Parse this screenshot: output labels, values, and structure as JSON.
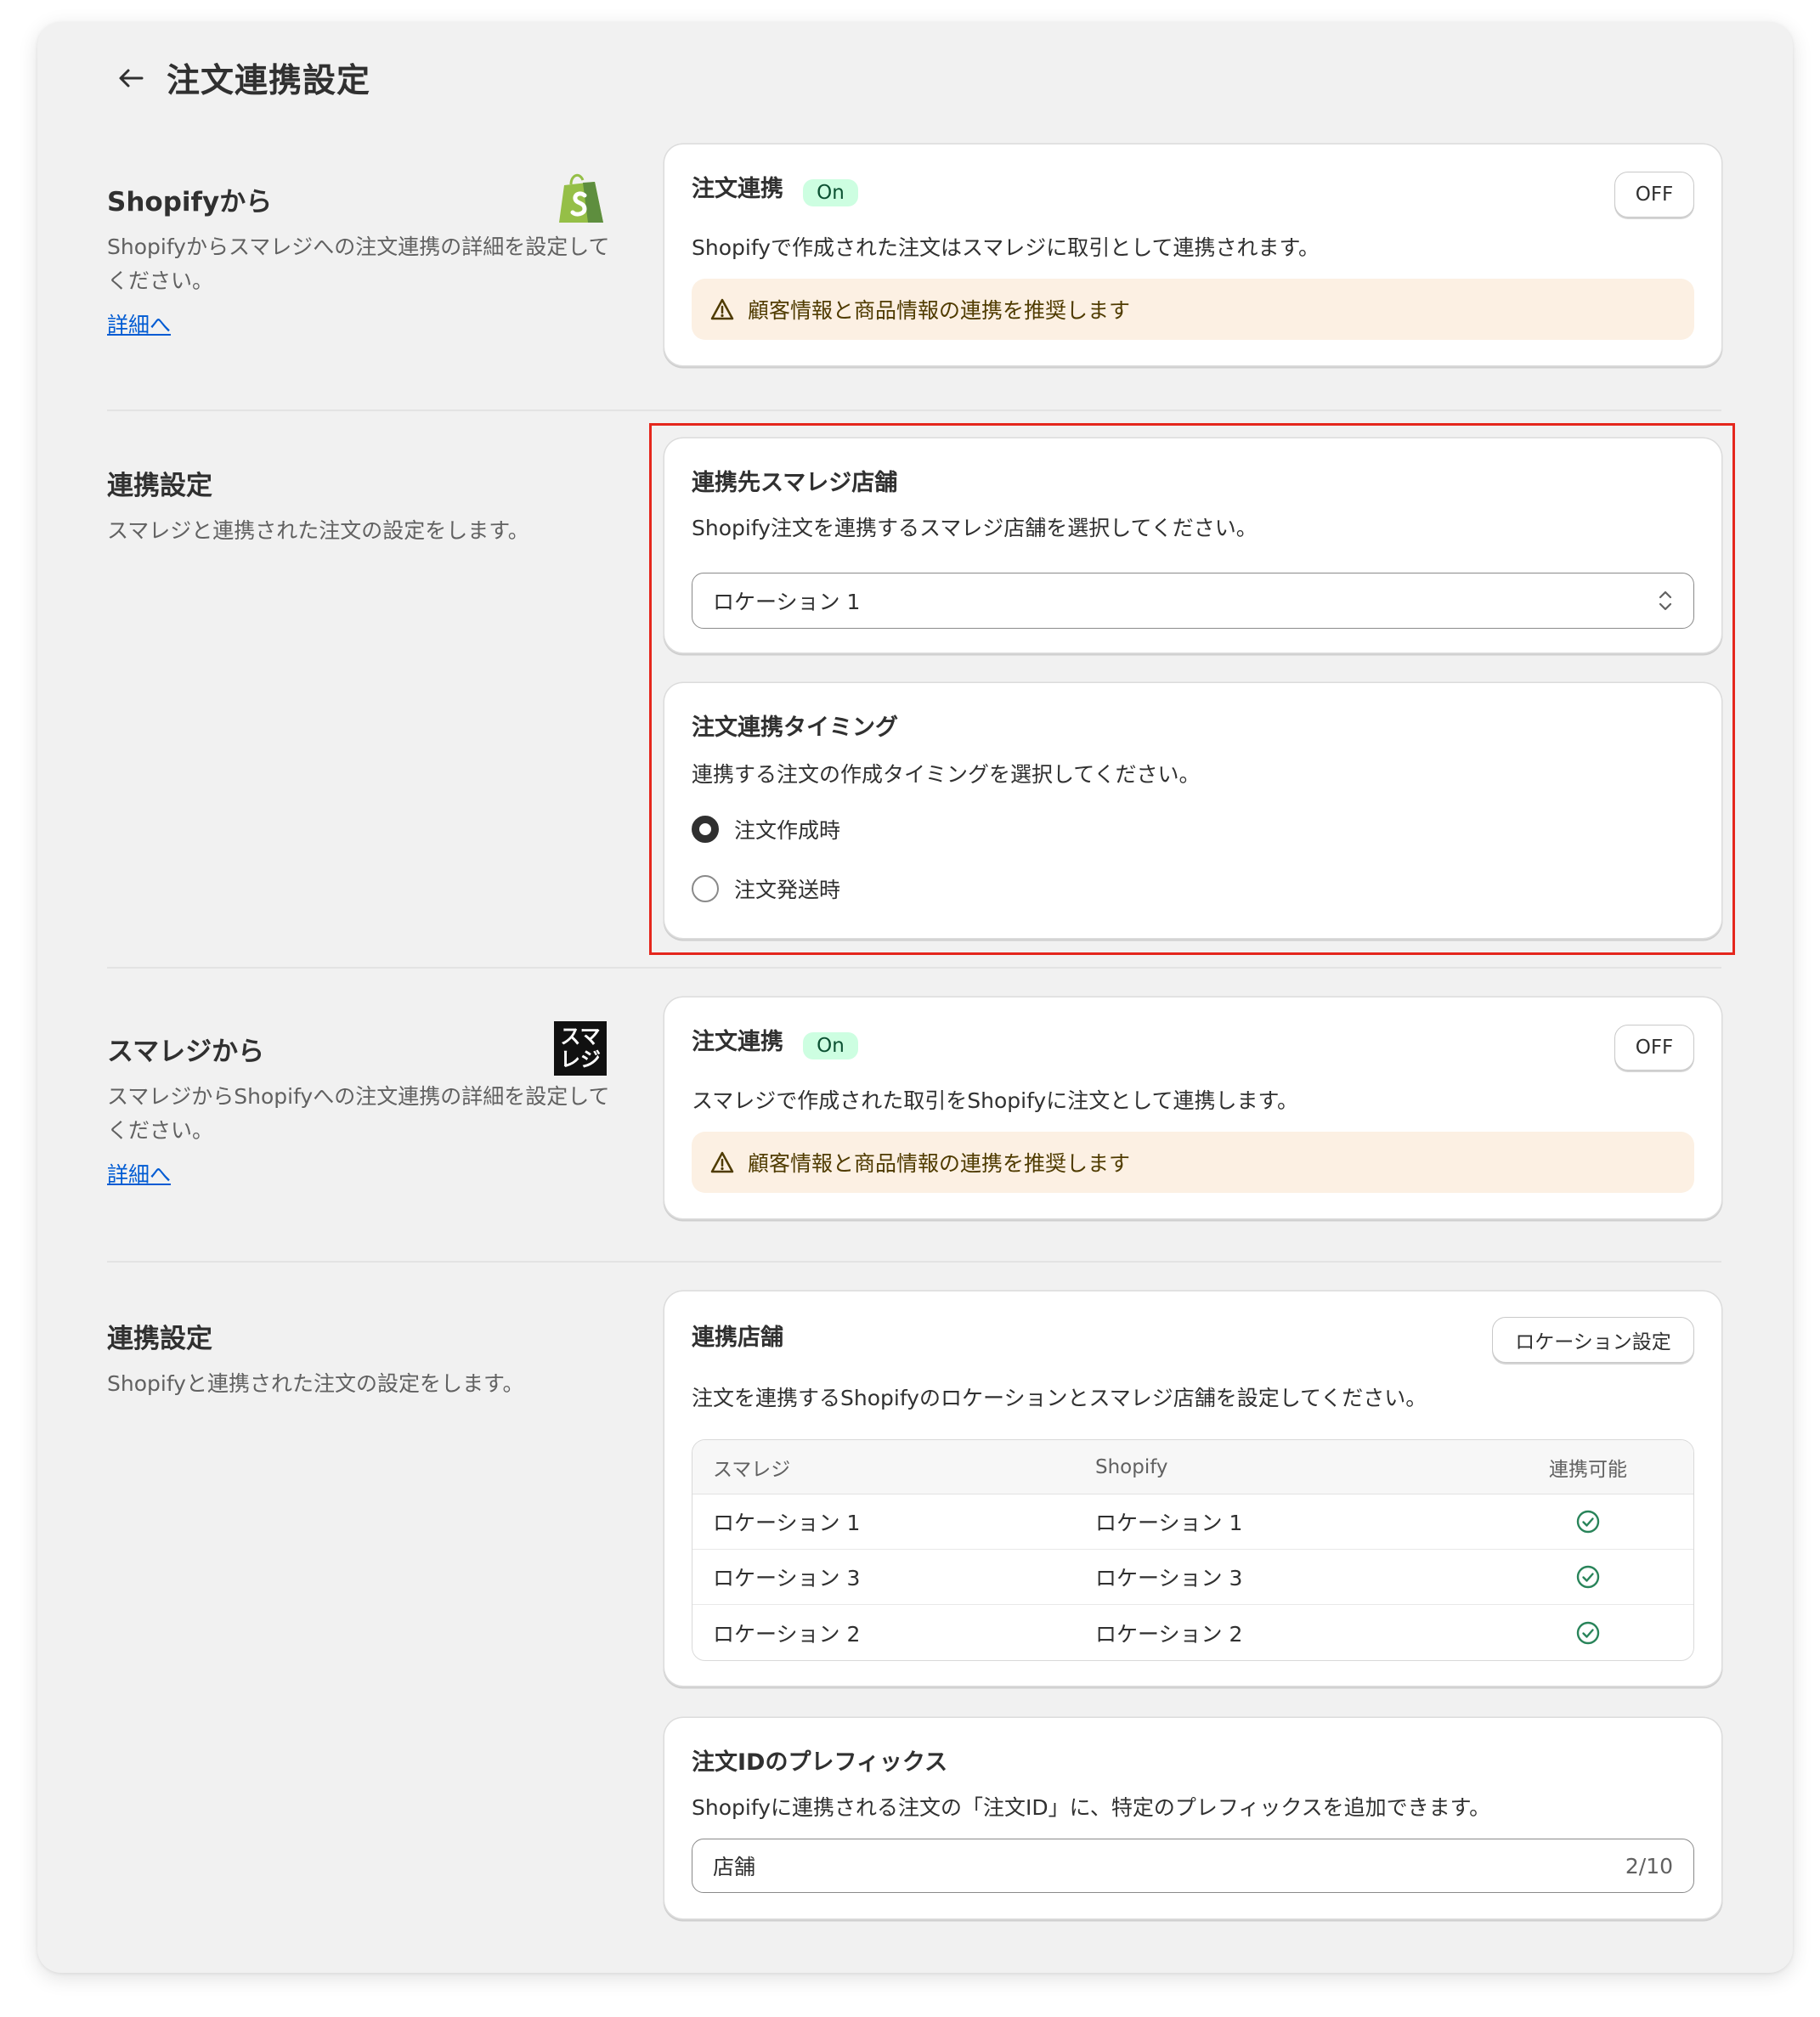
{
  "page": {
    "title": "注文連携設定"
  },
  "shopify_section": {
    "title": "Shopifyから",
    "description": "Shopifyからスマレジへの注文連携の詳細を設定してください。",
    "link": "詳細へ",
    "card": {
      "title": "注文連携",
      "badge": "On",
      "toggle_button": "OFF",
      "text": "Shopifyで作成された注文はスマレジに取引として連携されます。",
      "warning": "顧客情報と商品情報の連携を推奨します"
    }
  },
  "settings_section_1": {
    "title": "連携設定",
    "description": "スマレジと連携された注文の設定をします。",
    "store_card": {
      "title": "連携先スマレジ店舗",
      "text": "Shopify注文を連携するスマレジ店舗を選択してください。",
      "select_value": "ロケーション 1"
    },
    "timing_card": {
      "title": "注文連携タイミング",
      "text": "連携する注文の作成タイミングを選択してください。",
      "options": [
        {
          "label": "注文作成時",
          "checked": true
        },
        {
          "label": "注文発送時",
          "checked": false
        }
      ]
    }
  },
  "smaregi_section": {
    "title": "スマレジから",
    "logo_text": "スマレジ",
    "description": "スマレジからShopifyへの注文連携の詳細を設定してください。",
    "link": "詳細へ",
    "card": {
      "title": "注文連携",
      "badge": "On",
      "toggle_button": "OFF",
      "text": "スマレジで作成された取引をShopifyに注文として連携します。",
      "warning": "顧客情報と商品情報の連携を推奨します"
    }
  },
  "settings_section_2": {
    "title": "連携設定",
    "description": "Shopifyと連携された注文の設定をします。",
    "stores_card": {
      "title": "連携店舗",
      "button": "ロケーション設定",
      "text": "注文を連携するShopifyのロケーションとスマレジ店舗を設定してください。",
      "table": {
        "headers": [
          "スマレジ",
          "Shopify",
          "連携可能"
        ],
        "rows": [
          [
            "ロケーション 1",
            "ロケーション 1",
            "check"
          ],
          [
            "ロケーション 3",
            "ロケーション 3",
            "check"
          ],
          [
            "ロケーション 2",
            "ロケーション 2",
            "check"
          ]
        ]
      }
    },
    "prefix_card": {
      "title": "注文IDのプレフィックス",
      "text": "Shopifyに連携される注文の「注文ID」に、特定のプレフィックスを追加できます。",
      "input_value": "店舗",
      "counter": "2/10"
    }
  },
  "colors": {
    "shopify_green": "#95bf47",
    "badge_bg": "#cdfee1",
    "warning_bg": "#fcf0e3",
    "link": "#005bd3",
    "highlight": "#e5271d",
    "check": "#29845a"
  }
}
